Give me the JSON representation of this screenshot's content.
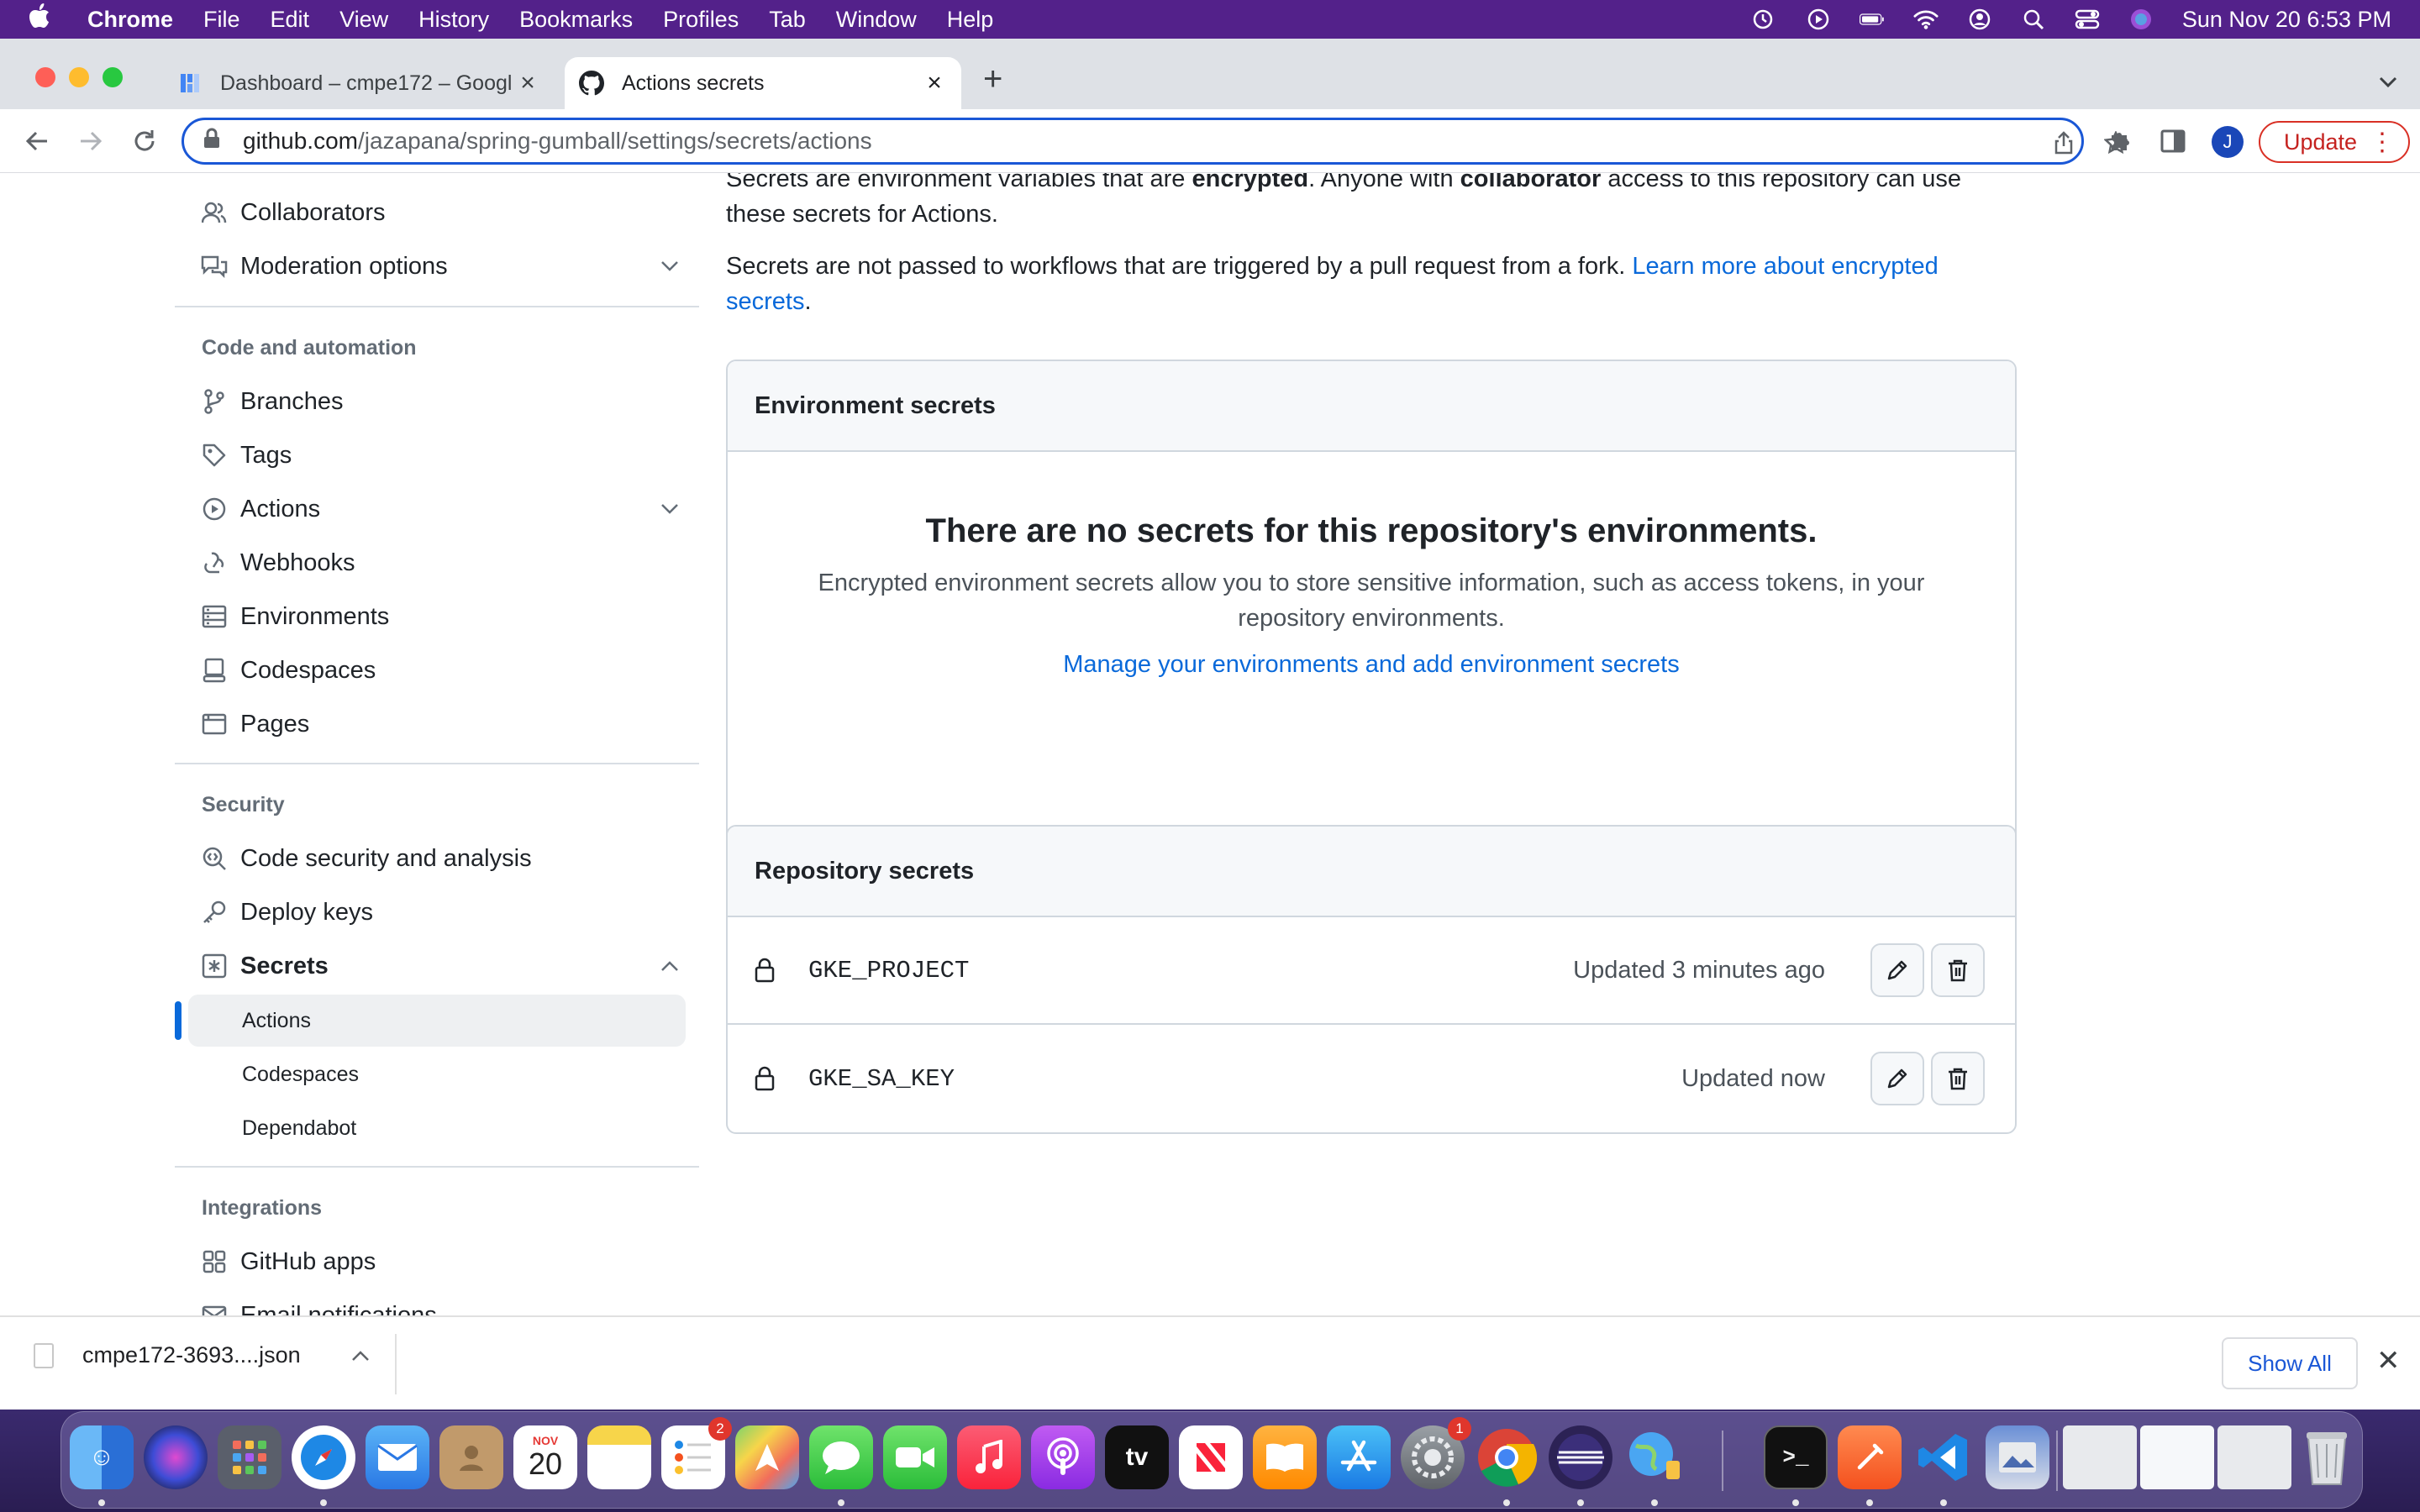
{
  "menubar": {
    "app": "Chrome",
    "items": [
      "File",
      "Edit",
      "View",
      "History",
      "Bookmarks",
      "Profiles",
      "Tab",
      "Window",
      "Help"
    ],
    "clock": "Sun Nov 20  6:53 PM"
  },
  "tabs": [
    {
      "title": "Dashboard – cmpe172 – Googl",
      "icon": "google-cloud-dashboard-icon"
    },
    {
      "title": "Actions secrets",
      "icon": "github-icon"
    }
  ],
  "address": {
    "host": "github.com",
    "path": "/jazapana/spring-gumball/settings/secrets/actions"
  },
  "profile": {
    "initial": "J"
  },
  "update_label": "Update",
  "sidebar": {
    "top_items": [
      {
        "label": "Collaborators",
        "icon": "people-icon"
      },
      {
        "label": "Moderation options",
        "icon": "comment-discussion-icon"
      }
    ],
    "code_heading": "Code and automation",
    "code_items": [
      {
        "label": "Branches",
        "icon": "git-branch-icon"
      },
      {
        "label": "Tags",
        "icon": "tag-icon"
      },
      {
        "label": "Actions",
        "icon": "play-icon"
      },
      {
        "label": "Webhooks",
        "icon": "webhook-icon"
      },
      {
        "label": "Environments",
        "icon": "server-icon"
      },
      {
        "label": "Codespaces",
        "icon": "codespaces-icon"
      },
      {
        "label": "Pages",
        "icon": "browser-icon"
      }
    ],
    "security_heading": "Security",
    "security_items": [
      {
        "label": "Code security and analysis",
        "icon": "codescan-icon"
      },
      {
        "label": "Deploy keys",
        "icon": "key-icon"
      },
      {
        "label": "Secrets",
        "icon": "key-asterisk-icon"
      }
    ],
    "secrets_sub": [
      "Actions",
      "Codespaces",
      "Dependabot"
    ],
    "integrations_heading": "Integrations",
    "integration_items": [
      {
        "label": "GitHub apps",
        "icon": "apps-icon"
      },
      {
        "label": "Email notifications",
        "icon": "mail-icon"
      }
    ]
  },
  "intro": {
    "line1_pre": "Secrets are environment variables that are ",
    "line1_b1": "encrypted",
    "line1_mid": ". Anyone with ",
    "line1_b2": "collaborator",
    "line1_post": " access to this repository can use",
    "line2": "these secrets for Actions.",
    "para2": "Secrets are not passed to workflows that are triggered by a pull request from a fork. ",
    "para2_link1": "Learn more about encrypted",
    "para2_link2": "secrets",
    "para2_end": "."
  },
  "env_secrets": {
    "heading": "Environment secrets",
    "blank_title": "There are no secrets for this repository's environments.",
    "blank_desc": "Encrypted environment secrets allow you to store sensitive information, such as access tokens, in your repository environments.",
    "blank_link": "Manage your environments and add environment secrets"
  },
  "repo_secrets": {
    "heading": "Repository secrets",
    "rows": [
      {
        "name": "GKE_PROJECT",
        "updated": "Updated 3 minutes ago"
      },
      {
        "name": "GKE_SA_KEY",
        "updated": "Updated now"
      }
    ]
  },
  "downloads": {
    "file": "cmpe172-3693....json",
    "show_all": "Show All"
  },
  "dock": {
    "calendar_month": "NOV",
    "calendar_day": "20",
    "reminders_badge": "2",
    "settings_badge": "1",
    "tv_label": "tv"
  }
}
